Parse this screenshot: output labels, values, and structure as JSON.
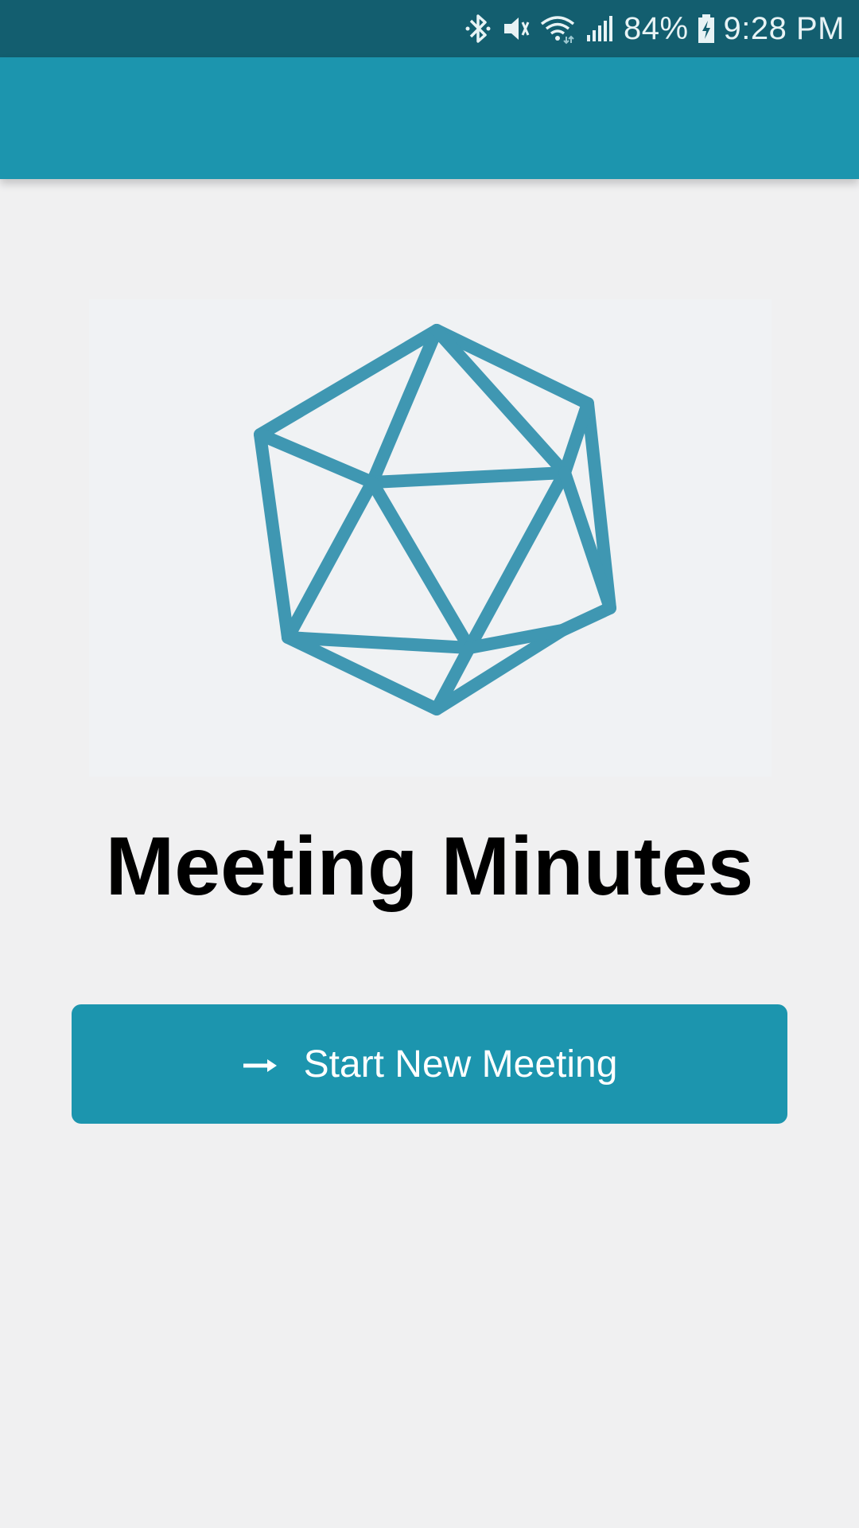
{
  "status_bar": {
    "battery": "84%",
    "time": "9:28 PM",
    "icons": [
      "bluetooth-icon",
      "vibrate-mute-icon",
      "wifi-icon",
      "signal-icon",
      "battery-charging-icon"
    ]
  },
  "app_bar": {
    "title": ""
  },
  "logo": {
    "icon": "icosahedron-logo",
    "color": "#3f97b2"
  },
  "main": {
    "title": "Meeting Minutes",
    "start_button_label": "Start New Meeting",
    "start_button_icon": "arrow-right-icon"
  },
  "colors": {
    "status_bar": "#135e6f",
    "primary": "#1c95ae",
    "background": "#f0f0f1"
  }
}
